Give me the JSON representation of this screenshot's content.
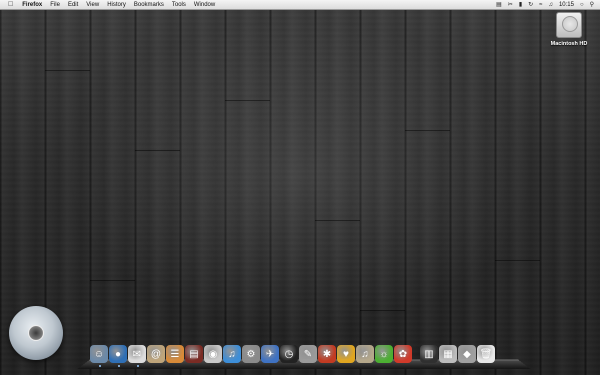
{
  "menubar": {
    "app_name": "Firefox",
    "menus": [
      "File",
      "Edit",
      "View",
      "History",
      "Bookmarks",
      "Tools",
      "Window"
    ],
    "clock": "10:15"
  },
  "desktop": {
    "drive_label": "Macintosh HD"
  },
  "dock": {
    "apps": [
      {
        "name": "finder-icon",
        "glyph": "☺",
        "color": "#6b89a8"
      },
      {
        "name": "firefox-icon",
        "glyph": "●",
        "color": "#2f6fb5"
      },
      {
        "name": "mail-icon",
        "glyph": "✉",
        "color": "#dcdcdc"
      },
      {
        "name": "address-book-icon",
        "glyph": "@",
        "color": "#bfa57a"
      },
      {
        "name": "ical-icon",
        "glyph": "☰",
        "color": "#d88a38"
      },
      {
        "name": "dictionary-icon",
        "glyph": "▤",
        "color": "#7a2b24"
      },
      {
        "name": "preview-icon",
        "glyph": "◉",
        "color": "#c9c9c9"
      },
      {
        "name": "itunes-icon",
        "glyph": "♫",
        "color": "#3d8ed8"
      },
      {
        "name": "system-preferences-icon",
        "glyph": "⚙",
        "color": "#8a8a8a"
      },
      {
        "name": "xcode-icon",
        "glyph": "✈",
        "color": "#3f72c2"
      },
      {
        "name": "time-machine-icon",
        "glyph": "◷",
        "color": "#222222"
      },
      {
        "name": "pen-icon",
        "glyph": "✎",
        "color": "#9a9a9a"
      },
      {
        "name": "bug-icon",
        "glyph": "✱",
        "color": "#c23b22"
      },
      {
        "name": "adium-icon",
        "glyph": "♥",
        "color": "#e0a620"
      },
      {
        "name": "notes-icon",
        "glyph": "♫",
        "color": "#b4a78a"
      },
      {
        "name": "dashcode-icon",
        "glyph": "☼",
        "color": "#4caf32"
      },
      {
        "name": "flower-icon",
        "glyph": "✿",
        "color": "#d03a2a"
      },
      {
        "name": "trash-can-icon",
        "glyph": "▥",
        "color": "#303030"
      },
      {
        "name": "documents-stack-icon",
        "glyph": "▦",
        "color": "#bcbcbc"
      },
      {
        "name": "downloads-stack-icon",
        "glyph": "◆",
        "color": "#a0a0a0"
      },
      {
        "name": "trash-icon",
        "glyph": "🗑",
        "color": "#e8e8e8"
      }
    ]
  }
}
